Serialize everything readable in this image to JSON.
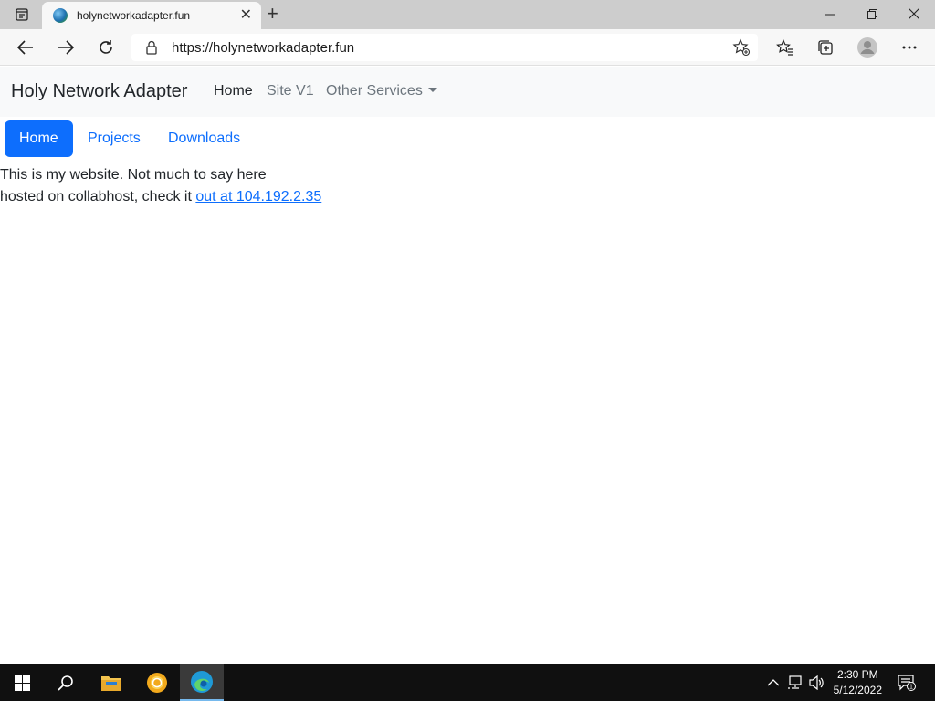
{
  "browser": {
    "tab_title": "holynetworkadapter.fun",
    "url": "https://holynetworkadapter.fun"
  },
  "navbar": {
    "brand": "Holy Network Adapter",
    "links": [
      "Home",
      "Site V1",
      "Other Services"
    ]
  },
  "pills": [
    "Home",
    "Projects",
    "Downloads"
  ],
  "content": {
    "line1": "This is my website. Not much to say here",
    "line2_prefix": "hosted on collabhost, check it ",
    "line2_link": "out at 104.192.2.35"
  },
  "taskbar": {
    "time": "2:30 PM",
    "date": "5/12/2022",
    "notification_count": "1"
  },
  "colors": {
    "accent": "#0d6efd",
    "navbar_bg": "#f8f9fa",
    "taskbar_bg": "#101010"
  }
}
